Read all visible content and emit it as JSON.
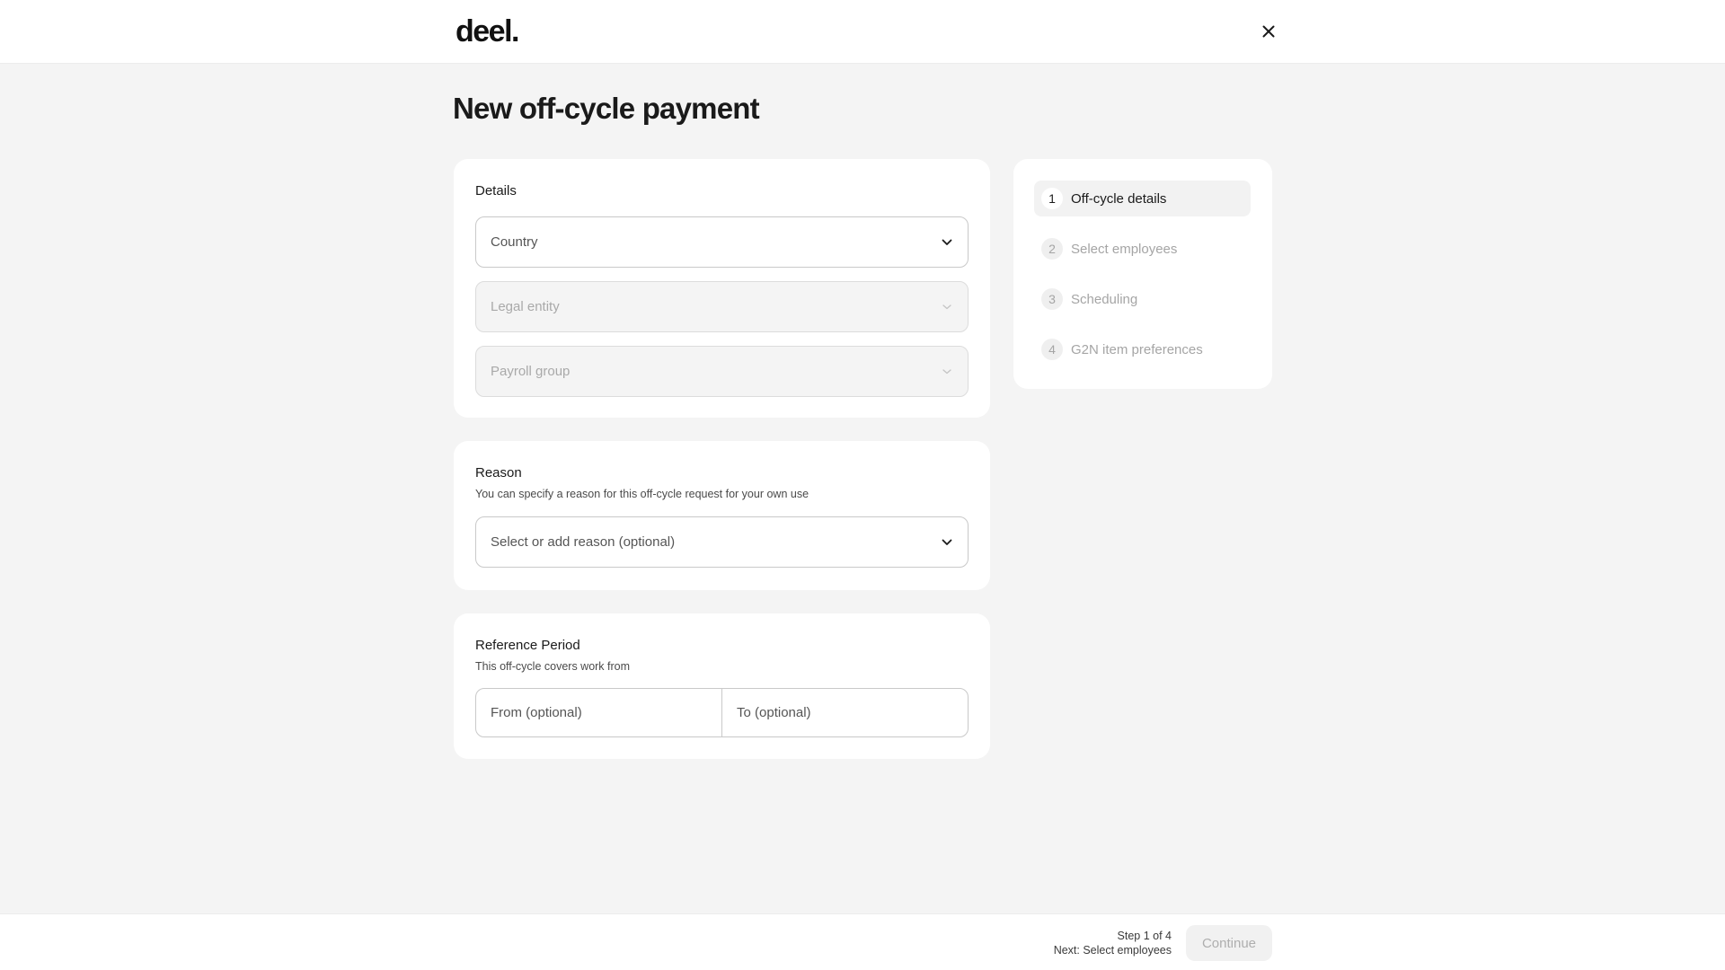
{
  "header": {
    "logo_text": "deel.",
    "close_icon": "close-icon"
  },
  "page": {
    "title": "New off-cycle payment"
  },
  "details": {
    "title": "Details",
    "country_label": "Country",
    "legal_entity_label": "Legal entity",
    "payroll_group_label": "Payroll group"
  },
  "reason": {
    "title": "Reason",
    "subtitle": "You can specify a reason for this off-cycle request for your own use",
    "select_label": "Select or add reason (optional)"
  },
  "reference_period": {
    "title": "Reference Period",
    "subtitle": "This off-cycle covers work from",
    "from_label": "From (optional)",
    "to_label": "To (optional)"
  },
  "steps": [
    {
      "number": "1",
      "label": "Off-cycle details",
      "active": true
    },
    {
      "number": "2",
      "label": "Select employees",
      "active": false
    },
    {
      "number": "3",
      "label": "Scheduling",
      "active": false
    },
    {
      "number": "4",
      "label": "G2N item preferences",
      "active": false
    }
  ],
  "footer": {
    "step_text": "Step 1 of 4",
    "next_text": "Next: Select employees",
    "continue_label": "Continue"
  },
  "colors": {
    "background": "#f4f4f4",
    "card": "#ffffff",
    "text_primary": "#1a1a1a",
    "text_muted": "#a5a5a5",
    "border": "#c9c9c9"
  }
}
